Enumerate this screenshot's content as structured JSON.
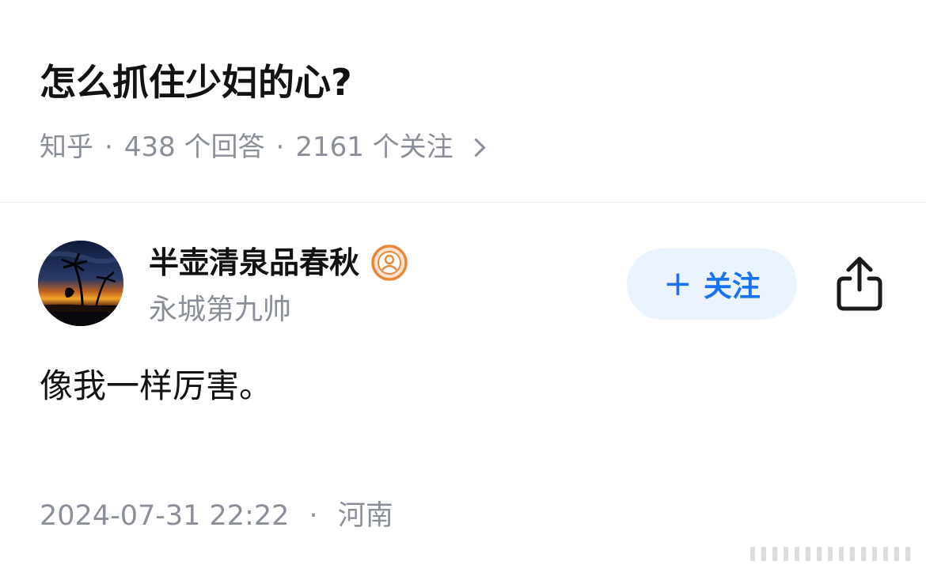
{
  "question": {
    "title": "怎么抓住少妇的心?",
    "source": "知乎",
    "answers_count": "438 个回答",
    "followers_count": "2161 个关注",
    "separator": "·"
  },
  "answer": {
    "author": {
      "name": "半壶清泉品春秋",
      "bio": "永城第九帅",
      "badge_icon": "user-badge-icon"
    },
    "follow_label": "关注",
    "follow_icon": "plus-icon",
    "share_icon": "share-icon",
    "content": "像我一样厉害。",
    "datetime": "2024-07-31 22:22",
    "location": "河南",
    "separator": "·"
  },
  "colors": {
    "primary_text": "#121212",
    "secondary_text": "#8a8f99",
    "accent_blue": "#1772f6",
    "follow_bg": "#ebf3ff",
    "badge_orange": "#e8893a"
  }
}
